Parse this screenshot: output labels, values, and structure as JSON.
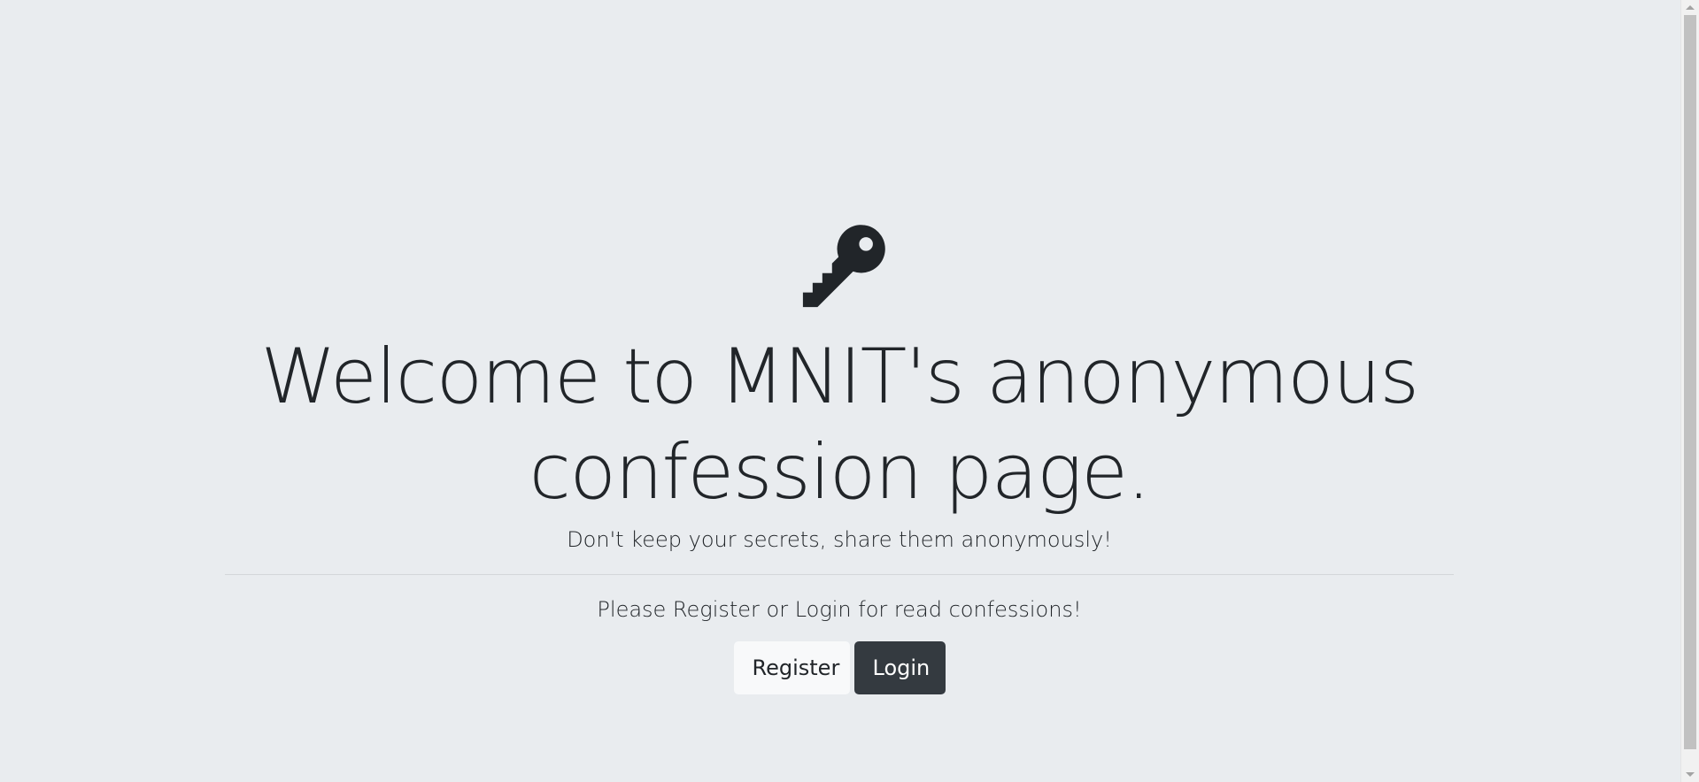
{
  "hero": {
    "icon": "key-icon",
    "title": "Welcome to MNIT's anonymous confession page.",
    "subtitle": "Don't keep your secrets, share them anonymously!",
    "prompt": "Please Register or Login for read confessions!"
  },
  "actions": {
    "register_label": "Register",
    "login_label": "Login"
  },
  "colors": {
    "background": "#e9ecef",
    "text": "#212529",
    "light_button": "#f8f9fa",
    "dark_button": "#343a40"
  }
}
